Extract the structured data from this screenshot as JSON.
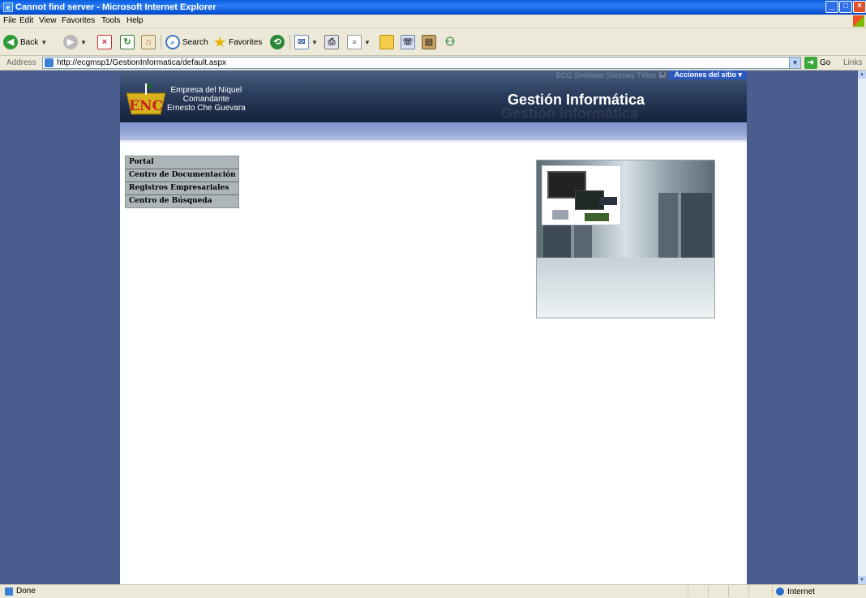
{
  "window": {
    "title": "Cannot find server - Microsoft Internet Explorer",
    "controls": [
      "minimize",
      "maximize",
      "close"
    ]
  },
  "menu": [
    "File",
    "Edit",
    "View",
    "Favorites",
    "Tools",
    "Help"
  ],
  "toolbar": {
    "back_label": "Back",
    "search_label": "Search",
    "favorites_label": "Favorites"
  },
  "addressbar": {
    "label": "Address",
    "url": "http://ecgmsp1/GestionInformatica/default.aspx",
    "go_label": "Go",
    "links_label": "Links"
  },
  "site": {
    "user_name": "ECG Shehisler Sánchez Téllez",
    "site_actions": "Acciones del sitio",
    "company_lines": [
      "Empresa del Níquel",
      "Comandante",
      "Ernesto Che Guevara"
    ],
    "title": "Gestión Informática",
    "nav_items": [
      "Portal",
      "Centro de Documentación",
      "Registros Empresariales",
      "Centro de Búsqueda"
    ]
  },
  "status": {
    "text": "Done",
    "zone": "Internet"
  },
  "colors": {
    "titlebar": "#0a5fe0",
    "viewport_bg": "#4b5d8f",
    "header_dark": "#13213c",
    "band": "#95a6d3",
    "nav_bg": "#aeb5b8",
    "site_actions": "#2c5ac4"
  }
}
